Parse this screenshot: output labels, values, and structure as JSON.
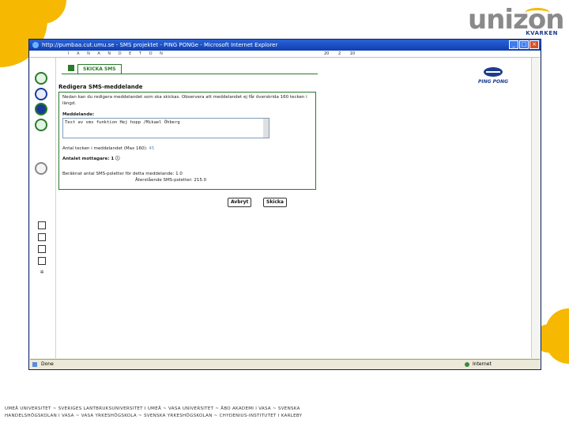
{
  "logo": {
    "text": "unizon",
    "sub": "KVARKEN"
  },
  "window": {
    "title": "http://pumbaa.cut.umu.se - SMS projektet - PING PONGe - Microsoft Internet Explorer",
    "toolbar_tabs": "I A N A N D E T O N",
    "toolbar_nums": "20 2 10"
  },
  "panel": {
    "header": "SKICKA SMS",
    "form_title": "Redigera SMS-meddelande",
    "intro": "Nedan kan du redigera meddelandet som ska skickas. Observera att meddelandet ej får överskrida 160 tecken i längd.",
    "message_label": "Meddelande:",
    "message_value": "Test av sms funktion Hej hopp /Mikael Öhberg",
    "char_count_label": "Antal tecken i meddelandet (Max 160):",
    "char_count_value": "45",
    "recipients_label": "Antalet mottagare: 1",
    "parts_count": "Beräknat antal SMS-poletter för detta meddelande: 1.0",
    "remaining": "Återstående SMS-poletter: 215.0",
    "cancel_label": "Avbryt",
    "send_label": "Skicka"
  },
  "ping_pong": {
    "text": "PING PONG"
  },
  "statusbar": {
    "status": "Done",
    "zone": "Internet"
  },
  "footer": {
    "line1": "UMEÅ UNIVERSITET ~ SVERIGES LANTBRUKSUNIVERSITET I UMEÅ ~ VASA UNIVERSITET ~ ÅBO AKADEMI I VASA ~ SVENSKA",
    "line2": "HANDELSHÖGSKOLAN I VASA ~ VASA YRKESHÖGSKOLA ~ SVENSKA YRKESHÖGSKOLAN ~ CHYDENIUS-INSTITUTET I KARLEBY"
  },
  "colors": {
    "accent_yellow": "#f6b800",
    "brand_blue": "#1e3c8c",
    "panel_green": "#2a7a2a"
  }
}
